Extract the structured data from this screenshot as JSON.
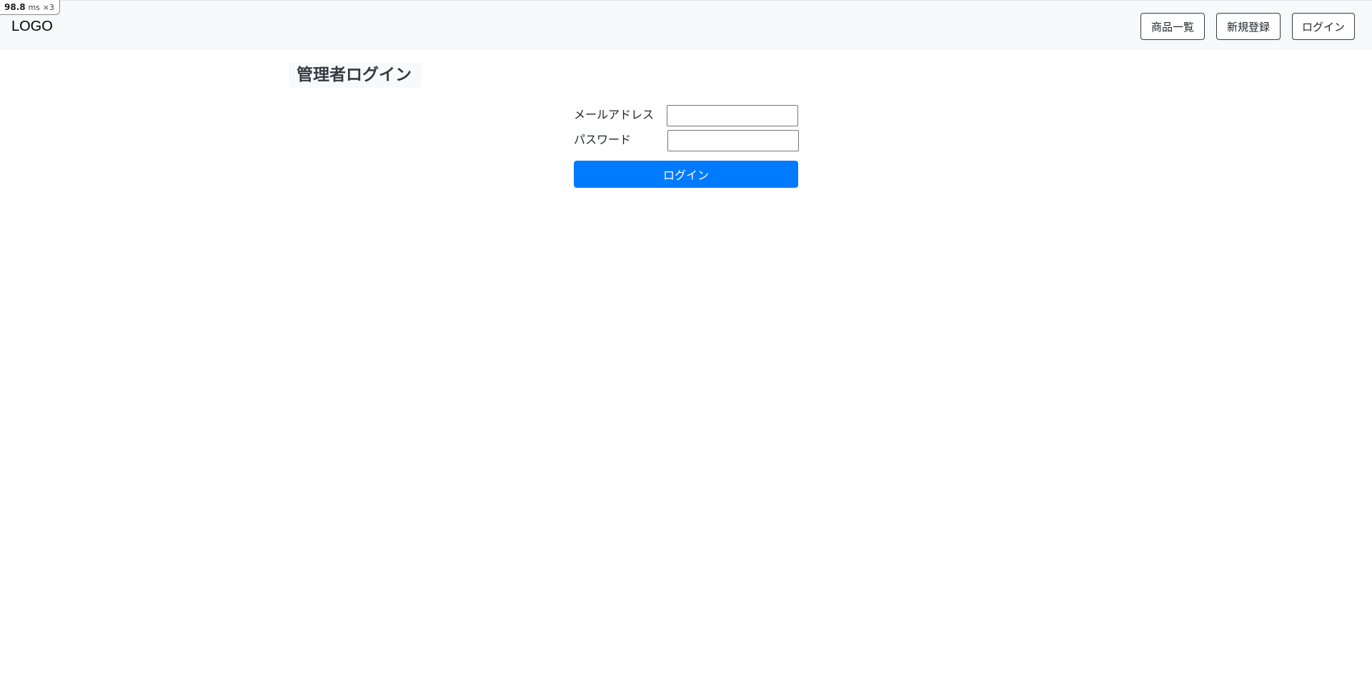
{
  "perf": {
    "value": "98.8",
    "unit": "ms",
    "multiplier": "×3"
  },
  "header": {
    "logo": "LOGO",
    "nav": {
      "products_label": "商品一覧",
      "register_label": "新規登録",
      "login_label": "ログイン"
    }
  },
  "main": {
    "title": "管理者ログイン",
    "form": {
      "email_label": "メールアドレス",
      "email_value": "",
      "password_label": "パスワード",
      "password_value": "",
      "submit_label": "ログイン"
    }
  },
  "colors": {
    "navbar_bg": "#f8f9fa",
    "primary": "#007bff",
    "title_text": "#343a40",
    "nav_border": "#343a40"
  }
}
